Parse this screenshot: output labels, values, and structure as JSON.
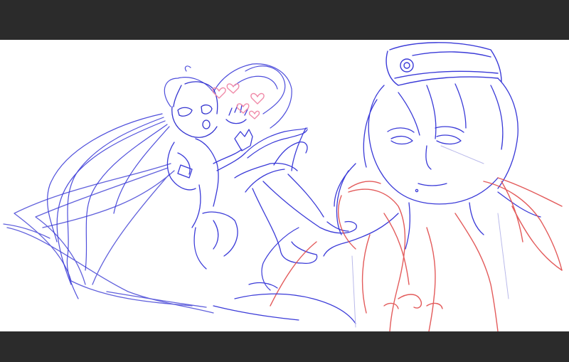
{
  "image": {
    "kind": "sketch",
    "letterbox_color": "#2b2b2b",
    "canvas_color": "#ffffff",
    "ink_colors": {
      "primary_lines": "#3a3ad8",
      "secondary_lines": "#e04a4a",
      "hearts": "#f08aa8"
    }
  }
}
